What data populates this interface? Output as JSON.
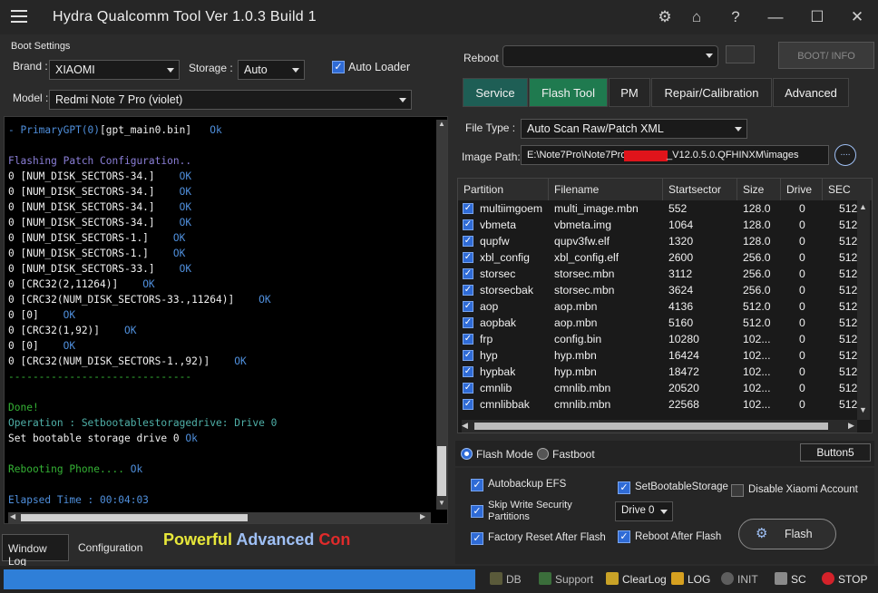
{
  "title": "Hydra Qualcomm  Tool  Ver 1.0.3 Build 1",
  "titlebar_icons": [
    "gear-icon",
    "home-icon",
    "help-icon",
    "minimize-icon",
    "maximize-icon",
    "close-icon"
  ],
  "titlebar_glyphs": {
    "gear": "⚙",
    "home": "⌂",
    "help": "?",
    "minimize": "—",
    "maximize": "☐",
    "close": "✕"
  },
  "boot_settings": {
    "section_label": "Boot Settings",
    "brand_label": "Brand :",
    "brand_value": "XIAOMI",
    "storage_label": "Storage :",
    "storage_value": "Auto",
    "auto_loader_label": "Auto Loader",
    "model_label": "Model :",
    "model_value": "Redmi Note 7 Pro (violet)"
  },
  "reboot": {
    "label": "Reboot",
    "value": "",
    "bootinfo_label": "BOOT/ INFO"
  },
  "main_tabs": [
    "Service",
    "Flash Tool",
    "PM",
    "Repair/Calibration",
    "Advanced"
  ],
  "file_type": {
    "label": "File Type :",
    "value": "Auto Scan Raw/Patch XML"
  },
  "image_path": {
    "label": "Image Path:",
    "value": "E:\\Note7Pro\\Note7Pro",
    "value_tail": "_V12.0.5.0.QFHINXM\\images",
    "browse_label": "...."
  },
  "log_lines": [
    {
      "parts": [
        {
          "t": "- PrimaryGPT(0)",
          "c": "c-blue"
        },
        {
          "t": "[gpt_main0.bin]",
          "c": "c-white"
        },
        {
          "t": "   Ok",
          "c": "c-ok"
        }
      ]
    },
    {
      "parts": [
        {
          "t": "",
          "c": "c-white"
        }
      ]
    },
    {
      "parts": [
        {
          "t": "Flashing Patch Configuration..",
          "c": "c-purple"
        }
      ]
    },
    {
      "parts": [
        {
          "t": "0 [NUM_DISK_SECTORS-34.]",
          "c": "c-white"
        },
        {
          "t": "    OK",
          "c": "c-ok"
        }
      ]
    },
    {
      "parts": [
        {
          "t": "0 [NUM_DISK_SECTORS-34.]",
          "c": "c-white"
        },
        {
          "t": "    OK",
          "c": "c-ok"
        }
      ]
    },
    {
      "parts": [
        {
          "t": "0 [NUM_DISK_SECTORS-34.]",
          "c": "c-white"
        },
        {
          "t": "    OK",
          "c": "c-ok"
        }
      ]
    },
    {
      "parts": [
        {
          "t": "0 [NUM_DISK_SECTORS-34.]",
          "c": "c-white"
        },
        {
          "t": "    OK",
          "c": "c-ok"
        }
      ]
    },
    {
      "parts": [
        {
          "t": "0 [NUM_DISK_SECTORS-1.]",
          "c": "c-white"
        },
        {
          "t": "    OK",
          "c": "c-ok"
        }
      ]
    },
    {
      "parts": [
        {
          "t": "0 [NUM_DISK_SECTORS-1.]",
          "c": "c-white"
        },
        {
          "t": "    OK",
          "c": "c-ok"
        }
      ]
    },
    {
      "parts": [
        {
          "t": "0 [NUM_DISK_SECTORS-33.]",
          "c": "c-white"
        },
        {
          "t": "    OK",
          "c": "c-ok"
        }
      ]
    },
    {
      "parts": [
        {
          "t": "0 [CRC32(2,11264)]",
          "c": "c-white"
        },
        {
          "t": "    OK",
          "c": "c-ok"
        }
      ]
    },
    {
      "parts": [
        {
          "t": "0 [CRC32(NUM_DISK_SECTORS-33.,11264)]",
          "c": "c-white"
        },
        {
          "t": "    OK",
          "c": "c-ok"
        }
      ]
    },
    {
      "parts": [
        {
          "t": "0 [0]",
          "c": "c-white"
        },
        {
          "t": "    OK",
          "c": "c-ok"
        }
      ]
    },
    {
      "parts": [
        {
          "t": "0 [CRC32(1,92)]",
          "c": "c-white"
        },
        {
          "t": "    OK",
          "c": "c-ok"
        }
      ]
    },
    {
      "parts": [
        {
          "t": "0 [0]",
          "c": "c-white"
        },
        {
          "t": "    OK",
          "c": "c-ok"
        }
      ]
    },
    {
      "parts": [
        {
          "t": "0 [CRC32(NUM_DISK_SECTORS-1.,92)]",
          "c": "c-white"
        },
        {
          "t": "    OK",
          "c": "c-ok"
        }
      ]
    },
    {
      "parts": [
        {
          "t": "------------------------------",
          "c": "c-green"
        }
      ]
    },
    {
      "parts": [
        {
          "t": "",
          "c": "c-white"
        }
      ]
    },
    {
      "parts": [
        {
          "t": "Done!",
          "c": "c-green"
        }
      ]
    },
    {
      "parts": [
        {
          "t": "Operation : Setbootablestoragedrive: Drive 0",
          "c": "c-teal"
        }
      ]
    },
    {
      "parts": [
        {
          "t": "Set bootable storage drive 0 ",
          "c": "c-white"
        },
        {
          "t": "Ok",
          "c": "c-ok"
        }
      ]
    },
    {
      "parts": [
        {
          "t": "",
          "c": "c-white"
        }
      ]
    },
    {
      "parts": [
        {
          "t": "Rebooting Phone.... ",
          "c": "c-green"
        },
        {
          "t": "Ok",
          "c": "c-ok"
        }
      ]
    },
    {
      "parts": [
        {
          "t": "",
          "c": "c-white"
        }
      ]
    },
    {
      "parts": [
        {
          "t": "Elapsed Time : 00:04:03",
          "c": "c-blue"
        }
      ]
    }
  ],
  "bottom_tabs": [
    "Window Log",
    "Configuration"
  ],
  "marquee": [
    {
      "t": "Powerful ",
      "color": "#e8e83a"
    },
    {
      "t": "Advanced ",
      "color": "#9fc0f5"
    },
    {
      "t": "Con",
      "color": "#e02b2b"
    }
  ],
  "table": {
    "columns": [
      "Partition",
      "Filename",
      "Startsector",
      "Size",
      "Drive",
      "SEC"
    ],
    "rows": [
      {
        "partition": "multiimgoem",
        "filename": "multi_image.mbn",
        "start": "552",
        "size": "128.0",
        "drive": "0",
        "sec": "512"
      },
      {
        "partition": "vbmeta",
        "filename": "vbmeta.img",
        "start": "1064",
        "size": "128.0",
        "drive": "0",
        "sec": "512"
      },
      {
        "partition": "qupfw",
        "filename": "qupv3fw.elf",
        "start": "1320",
        "size": "128.0",
        "drive": "0",
        "sec": "512"
      },
      {
        "partition": "xbl_config",
        "filename": "xbl_config.elf",
        "start": "2600",
        "size": "256.0",
        "drive": "0",
        "sec": "512"
      },
      {
        "partition": "storsec",
        "filename": "storsec.mbn",
        "start": "3112",
        "size": "256.0",
        "drive": "0",
        "sec": "512"
      },
      {
        "partition": "storsecbak",
        "filename": "storsec.mbn",
        "start": "3624",
        "size": "256.0",
        "drive": "0",
        "sec": "512"
      },
      {
        "partition": "aop",
        "filename": "aop.mbn",
        "start": "4136",
        "size": "512.0",
        "drive": "0",
        "sec": "512"
      },
      {
        "partition": "aopbak",
        "filename": "aop.mbn",
        "start": "5160",
        "size": "512.0",
        "drive": "0",
        "sec": "512"
      },
      {
        "partition": "frp",
        "filename": "config.bin",
        "start": "10280",
        "size": "102...",
        "drive": "0",
        "sec": "512"
      },
      {
        "partition": "hyp",
        "filename": "hyp.mbn",
        "start": "16424",
        "size": "102...",
        "drive": "0",
        "sec": "512"
      },
      {
        "partition": "hypbak",
        "filename": "hyp.mbn",
        "start": "18472",
        "size": "102...",
        "drive": "0",
        "sec": "512"
      },
      {
        "partition": "cmnlib",
        "filename": "cmnlib.mbn",
        "start": "20520",
        "size": "102...",
        "drive": "0",
        "sec": "512"
      },
      {
        "partition": "cmnlibbak",
        "filename": "cmnlib.mbn",
        "start": "22568",
        "size": "102...",
        "drive": "0",
        "sec": "512"
      }
    ]
  },
  "mode": {
    "flash_label": "Flash Mode",
    "fastboot_label": "Fastboot",
    "button5_label": "Button5"
  },
  "options": {
    "autobackup_efs": "Autobackup EFS",
    "set_bootable": "SetBootableStorage",
    "disable_xiaomi": "Disable Xiaomi Account",
    "skip_write_1": "Skip Write Security",
    "skip_write_2": "Partitions",
    "drive_value": "Drive 0",
    "factory_reset": "Factory Reset After Flash",
    "reboot_after": "Reboot After Flash",
    "flash_button": "Flash"
  },
  "statusbar": [
    {
      "label": "DB",
      "icon": "database-icon"
    },
    {
      "label": "Support",
      "icon": "support-icon"
    },
    {
      "label": "ClearLog",
      "icon": "broom-icon"
    },
    {
      "label": "LOG",
      "icon": "log-icon"
    },
    {
      "label": "INIT",
      "icon": "init-icon"
    },
    {
      "label": "SC",
      "icon": "screenshot-icon"
    },
    {
      "label": "STOP",
      "icon": "stop-icon"
    }
  ],
  "colors": {
    "accent_blue": "#2f7fd8",
    "tab_active": "#1f7a4f",
    "tab_service": "#1e5e55"
  }
}
